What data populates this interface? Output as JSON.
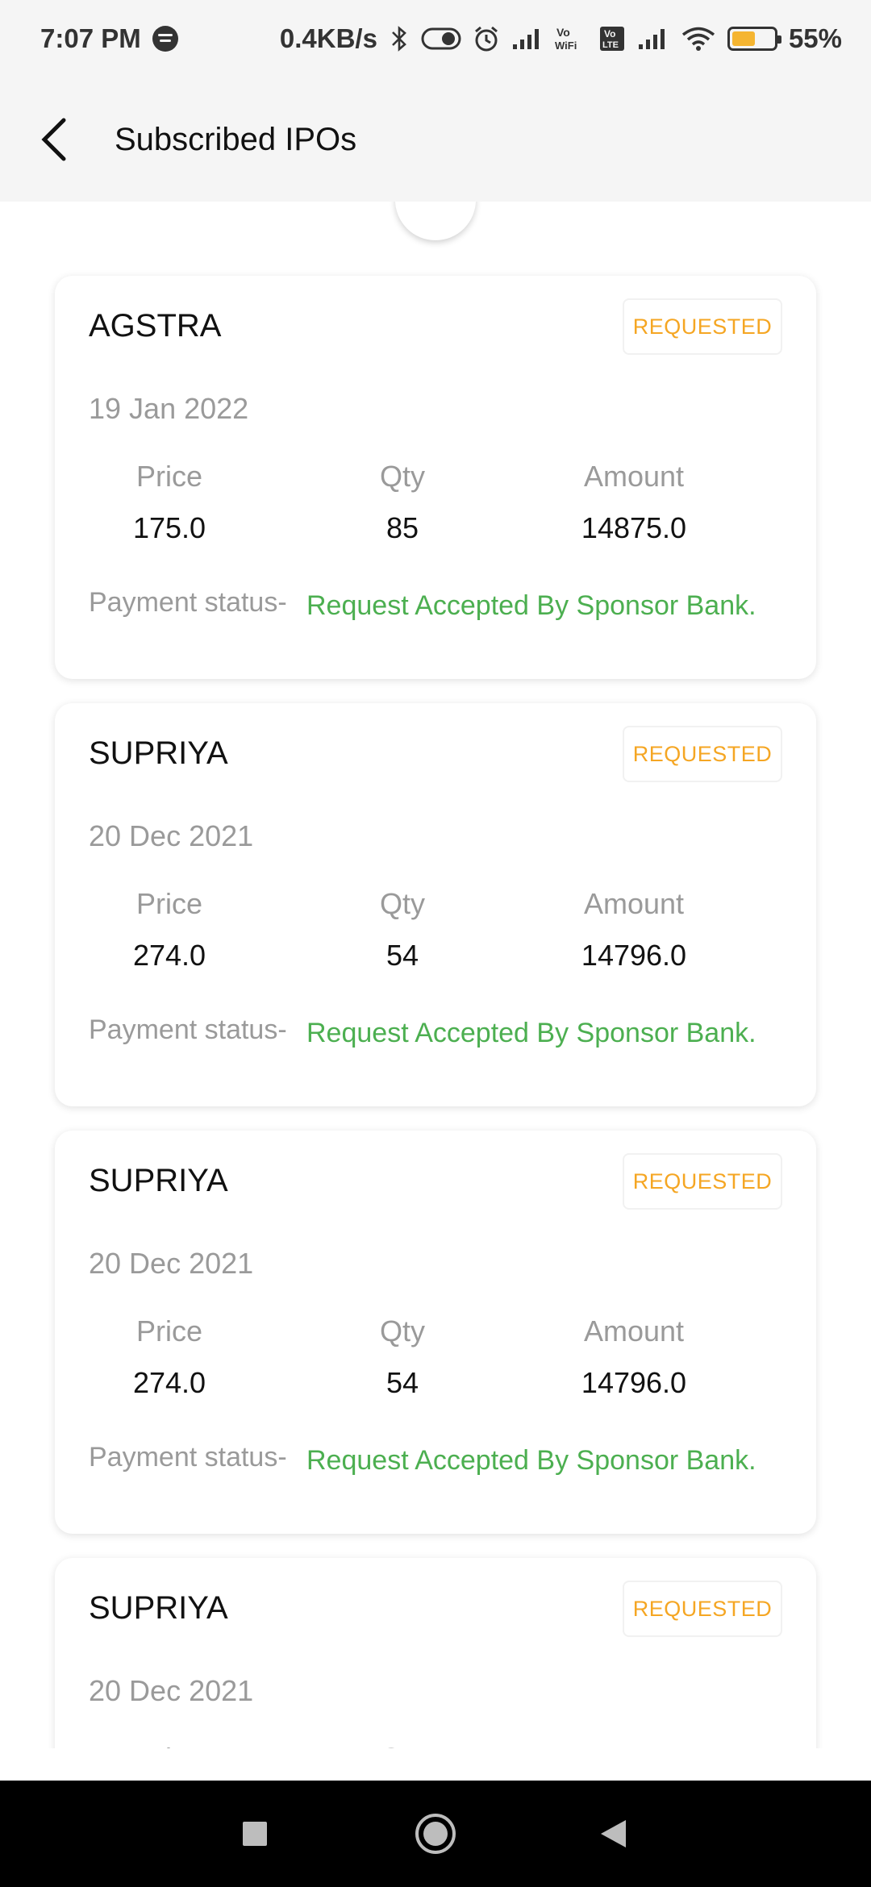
{
  "status_bar": {
    "time": "7:07 PM",
    "network_speed": "0.4KB/s",
    "battery_percent": "55%",
    "battery_level": 0.55,
    "icons": [
      "spotify-icon",
      "bluetooth-icon",
      "toggle-icon",
      "alarm-icon",
      "signal-icon",
      "vowifi-icon",
      "volte-icon",
      "signal-icon",
      "wifi-icon",
      "battery-icon"
    ],
    "vowifi_text": "Vo WiFi",
    "volte_text": "Vo LTE"
  },
  "app_bar": {
    "title": "Subscribed IPOs"
  },
  "labels": {
    "price": "Price",
    "qty": "Qty",
    "amount": "Amount",
    "payment_status": "Payment status-"
  },
  "colors": {
    "requested": "#f5a623",
    "payment_ok": "#4caf50",
    "muted": "#9a9a9a"
  },
  "ipos": [
    {
      "name": "AGSTRA",
      "status": "REQUESTED",
      "date": "19 Jan 2022",
      "price": "175.0",
      "qty": "85",
      "amount": "14875.0",
      "payment_status": "Request Accepted By Sponsor Bank."
    },
    {
      "name": "SUPRIYA",
      "status": "REQUESTED",
      "date": "20 Dec 2021",
      "price": "274.0",
      "qty": "54",
      "amount": "14796.0",
      "payment_status": "Request Accepted By Sponsor Bank."
    },
    {
      "name": "SUPRIYA",
      "status": "REQUESTED",
      "date": "20 Dec 2021",
      "price": "274.0",
      "qty": "54",
      "amount": "14796.0",
      "payment_status": "Request Accepted By Sponsor Bank."
    },
    {
      "name": "SUPRIYA",
      "status": "REQUESTED",
      "date": "20 Dec 2021"
    }
  ],
  "nav_bar": {
    "buttons": [
      "recents-square-icon",
      "home-circle-icon",
      "back-triangle-icon"
    ]
  }
}
